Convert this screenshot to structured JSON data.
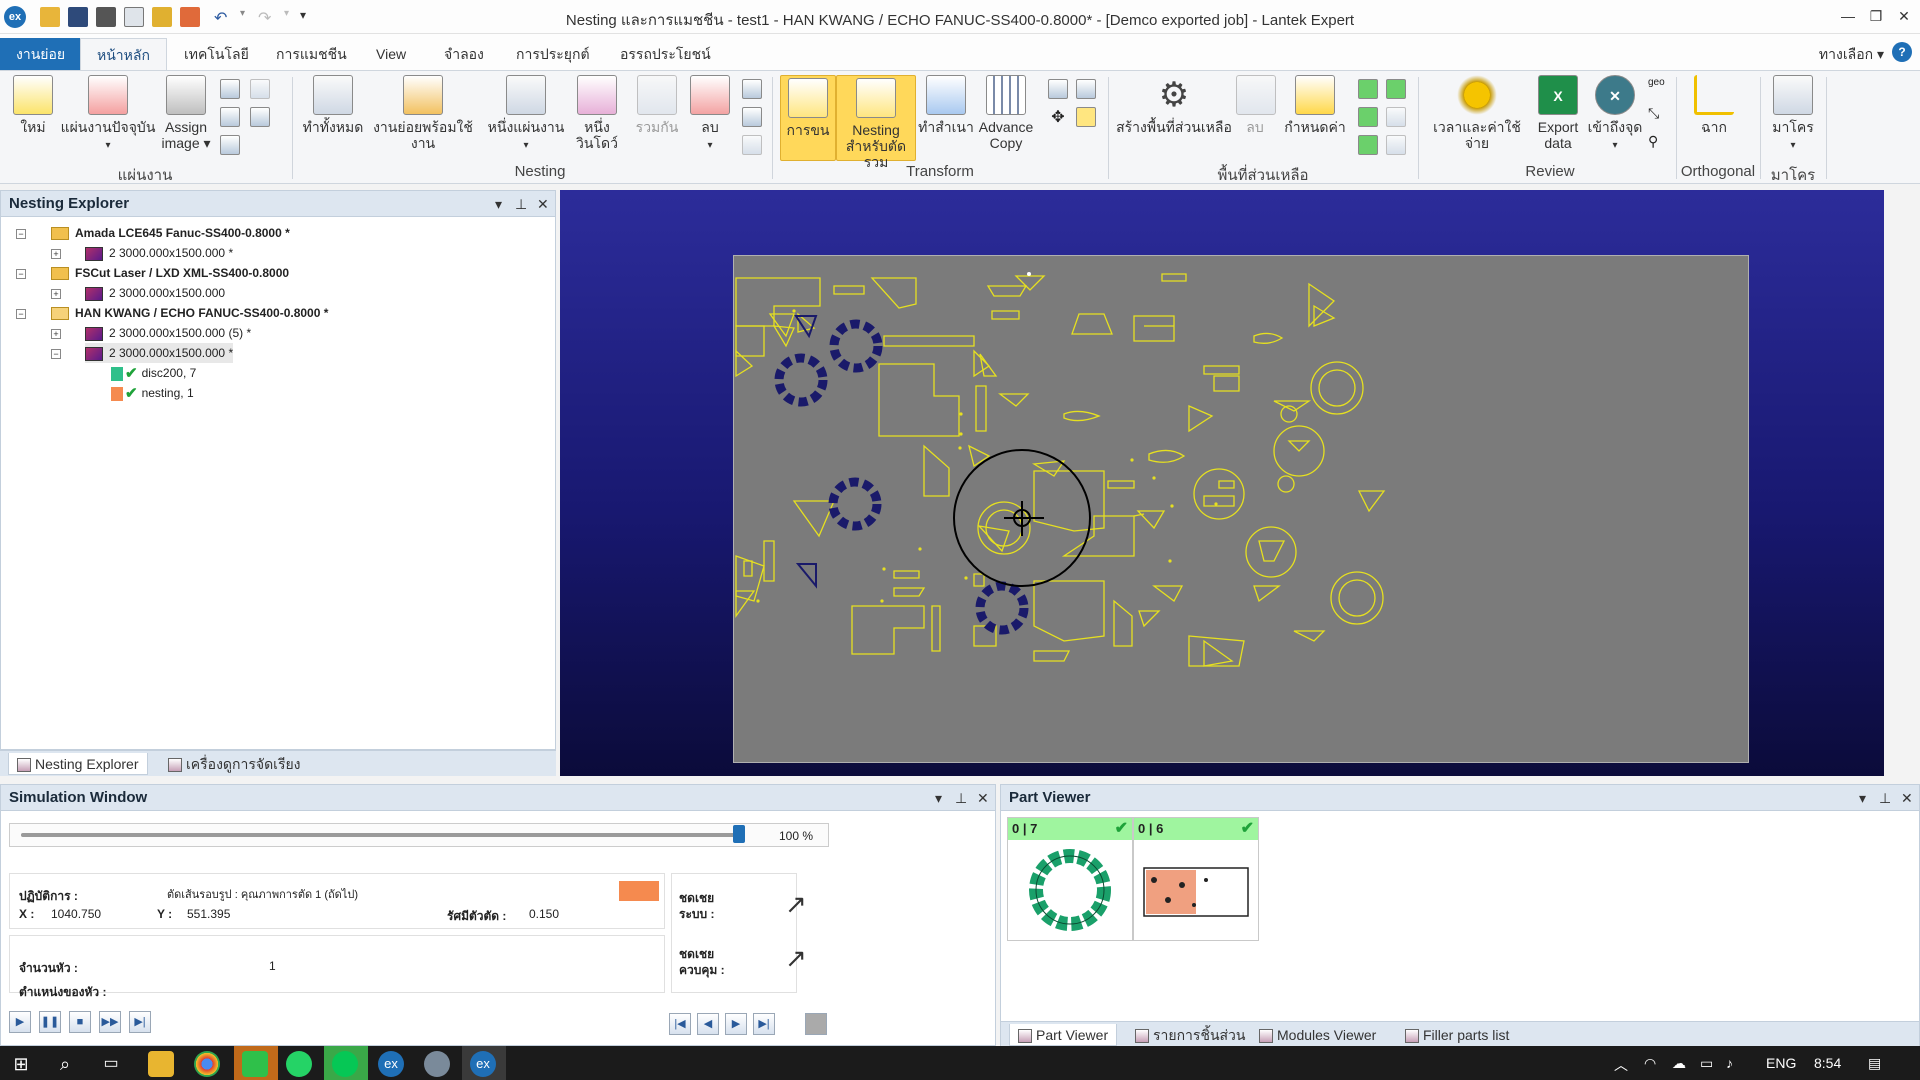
{
  "window": {
    "app_icon": "ex",
    "title": "Nesting และการแมชชีน - test1 - HAN KWANG / ECHO FANUC-SS400-0.8000* - [Demco exported job] - Lantek Expert",
    "controls": [
      "—",
      "❐",
      "✕"
    ]
  },
  "tabs": {
    "file": "งานย่อย",
    "items": [
      "หน้าหลัก",
      "เทคโนโลยี",
      "การแมชชีน",
      "View",
      "จำลอง",
      "การประยุกต์",
      "อรรถประโยชน์"
    ],
    "options": "ทางเลือก ▾",
    "help": "?"
  },
  "ribbon": {
    "groups": {
      "sheet": "แผ่นงาน",
      "nesting": "Nesting",
      "transform": "Transform",
      "remnant": "พื้นที่ส่วนเหลือ",
      "review": "Review",
      "orthogonal": "Orthogonal",
      "macro": "มาโคร"
    },
    "buttons": {
      "new": "ใหม่",
      "current_sheet": "แผ่นงานปัจจุบัน",
      "assign_image_1": "Assign",
      "assign_image_2": "image ▾",
      "do_all": "ทำทั้งหมด",
      "ready_parts": "งานย่อยพร้อมใช้งาน",
      "one_sheet": "หนึ่งแผ่นงาน",
      "one_window": "หนึ่งวินโดว์",
      "merge": "รวมกัน",
      "delete": "ลบ",
      "move": "การขน",
      "nesting_cut_1": "Nesting",
      "nesting_cut_2": "สำหรับตัดรวม",
      "copy": "ทำสำเนา",
      "advance_copy_1": "Advance",
      "advance_copy_2": "Copy",
      "create_remnant": "สร้างพื้นที่ส่วนเหลือ",
      "remnant_delete": "ลบ",
      "define": "กำหนดค่า",
      "time_cost": "เวลาและค่าใช้จ่าย",
      "export_1": "Export",
      "export_2": "data",
      "reach_point": "เข้าถึงจุด",
      "drag": "ฉาก",
      "macro": "มาโคร"
    }
  },
  "explorer": {
    "title": "Nesting Explorer",
    "items": [
      {
        "label": "Amada LCE645 Fanuc-SS400-0.8000 *"
      },
      {
        "label": "2 3000.000x1500.000 *"
      },
      {
        "label": "FSCut Laser / LXD XML-SS400-0.8000"
      },
      {
        "label": "2 3000.000x1500.000"
      },
      {
        "label": "HAN KWANG / ECHO FANUC-SS400-0.8000 *"
      },
      {
        "label": "2 3000.000x1500.000 (5) *"
      },
      {
        "label": "2 3000.000x1500.000 *"
      },
      {
        "label": "disc200, 7"
      },
      {
        "label": "nesting, 1"
      }
    ],
    "bottom_tabs": [
      "Nesting Explorer",
      "เครื่องดูการจัดเรียง"
    ]
  },
  "simulation": {
    "title": "Simulation Window",
    "progress": 1.0,
    "percent": "100 %",
    "operation_label": "ปฏิบัติการ :",
    "operation_value": "ตัดเส้นรอบรูป : คุณภาพการตัด 1 (ถัดไป)",
    "x_label": "X :",
    "x_value": "1040.750",
    "y_label": "Y :",
    "y_value": "551.395",
    "radius_label": "รัศมีตัวตัด :",
    "radius_value": "0.150",
    "head_count_label": "จำนวนหัว :",
    "head_count_value": "1",
    "head_pos_label": "ตำแหน่งของหัว :",
    "comp_system_1": "ชดเชย",
    "comp_system_2": "ระบบ :",
    "comp_control_1": "ชดเชย",
    "comp_control_2": "ควบคุม :",
    "colors": {
      "operation_swatch": "#f58a4f"
    }
  },
  "part_viewer": {
    "title": "Part Viewer",
    "cards": [
      {
        "count": "0 | 7"
      },
      {
        "count": "0 | 6"
      }
    ],
    "bottom_tabs": [
      "Part Viewer",
      "รายการชิ้นส่วน",
      "Modules Viewer",
      "Filler parts list"
    ]
  },
  "taskbar": {
    "lang": "ENG",
    "time": "8:54"
  }
}
